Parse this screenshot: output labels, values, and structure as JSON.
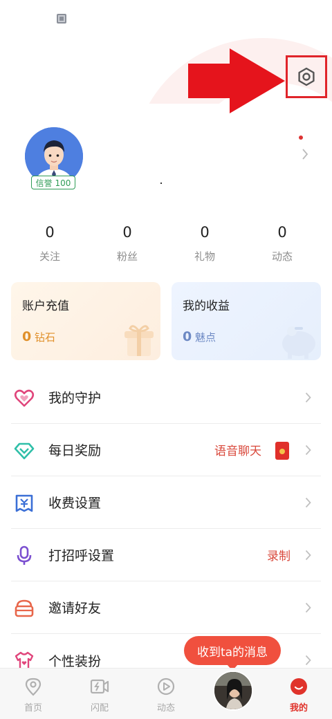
{
  "profile": {
    "credit_badge": "信誉 100"
  },
  "stats": [
    {
      "value": "0",
      "label": "关注"
    },
    {
      "value": "0",
      "label": "粉丝"
    },
    {
      "value": "0",
      "label": "礼物"
    },
    {
      "value": "0",
      "label": "动态"
    }
  ],
  "cards": {
    "recharge": {
      "title": "账户充值",
      "amount": "0",
      "unit": "钻石"
    },
    "income": {
      "title": "我的收益",
      "amount": "0",
      "unit": "魅点"
    }
  },
  "menu": [
    {
      "label": "我的守护",
      "right": "",
      "icon": "heart-shield-icon"
    },
    {
      "label": "每日奖励",
      "right": "语音聊天",
      "icon": "diamond-icon"
    },
    {
      "label": "收费设置",
      "right": "",
      "icon": "yen-receipt-icon"
    },
    {
      "label": "打招呼设置",
      "right": "录制",
      "icon": "microphone-icon"
    },
    {
      "label": "邀请好友",
      "right": "",
      "icon": "mailbox-icon"
    },
    {
      "label": "个性装扮",
      "right": "",
      "icon": "shirt-icon"
    }
  ],
  "bubble": {
    "text": "收到ta的消息"
  },
  "tabs": [
    {
      "label": "首页",
      "icon": "location-pin-icon"
    },
    {
      "label": "闪配",
      "icon": "video-flash-icon"
    },
    {
      "label": "动态",
      "icon": "play-circle-icon"
    },
    {
      "label": "",
      "icon": "avatar"
    },
    {
      "label": "我的",
      "icon": "me-icon"
    }
  ],
  "colors": {
    "accent": "#e0332b",
    "highlight_box": "#e0242a",
    "credit_green": "#2e9b55",
    "diamond_orange": "#e0902a",
    "charm_blue": "#6d89c4"
  }
}
